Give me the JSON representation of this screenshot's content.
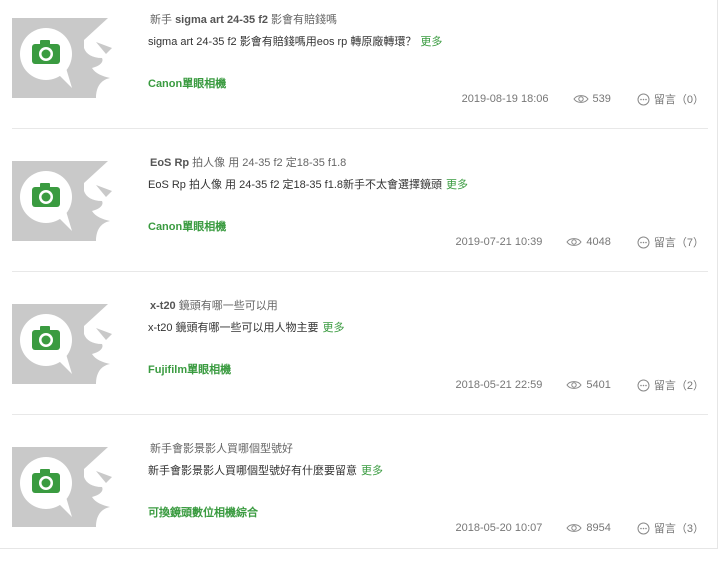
{
  "colors": {
    "accent_green": "#3a9b40",
    "thumb_bg": "#c9c9c9",
    "meta_text": "#777777",
    "divider": "#e8e8e8"
  },
  "posts": [
    {
      "title_prefix": "新手 ",
      "title_bold": "sigma art 24-35 f2",
      "title_suffix": " 影會有賠錢嗎",
      "excerpt": "sigma art 24-35 f2 影會有賠錢嗎用eos rp 轉原廠轉環？",
      "more_label": "更多",
      "category": "Canon單眼相機",
      "date": "2019-08-19 18:06",
      "views": "539",
      "comments_label": "留言（0）",
      "thumb_icon": "camera-speech-bubble-icon"
    },
    {
      "title_prefix": "",
      "title_bold": "EoS Rp",
      "title_suffix": " 拍人像 用 24-35 f2 定18-35 f1.8",
      "excerpt": "EoS Rp 拍人像 用 24-35 f2 定18-35 f1.8新手不太會選擇鏡頭",
      "more_label": "更多",
      "category": "Canon單眼相機",
      "date": "2019-07-21 10:39",
      "views": "4048",
      "comments_label": "留言（7）",
      "thumb_icon": "camera-speech-bubble-icon"
    },
    {
      "title_prefix": "",
      "title_bold": "x-t20",
      "title_suffix": " 鏡頭有哪一些可以用",
      "excerpt": "x-t20 鏡頭有哪一些可以用人物主要",
      "more_label": "更多",
      "category": "Fujifilm單眼相機",
      "date": "2018-05-21 22:59",
      "views": "5401",
      "comments_label": "留言（2）",
      "thumb_icon": "camera-speech-bubble-icon"
    },
    {
      "title_prefix": "新手會影景影人買哪個型號好",
      "title_bold": "",
      "title_suffix": "",
      "excerpt": "新手會影景影人買哪個型號好有什麼要留意",
      "more_label": "更多",
      "category": "可換鏡頭數位相機綜合",
      "date": "2018-05-20 10:07",
      "views": "8954",
      "comments_label": "留言（3）",
      "thumb_icon": "camera-speech-bubble-icon"
    }
  ]
}
